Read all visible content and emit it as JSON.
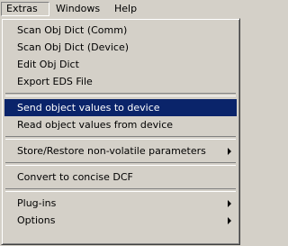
{
  "menubar": {
    "items": [
      {
        "label": "Extras"
      },
      {
        "label": "Windows"
      },
      {
        "label": "Help"
      }
    ]
  },
  "menu": {
    "group1": [
      {
        "label": "Scan Obj Dict (Comm)"
      },
      {
        "label": "Scan Obj Dict (Device)"
      },
      {
        "label": "Edit Obj Dict"
      },
      {
        "label": "Export EDS File"
      }
    ],
    "group2": [
      {
        "label": "Send object values to device",
        "highlighted": true
      },
      {
        "label": "Read object values from device"
      }
    ],
    "group3": [
      {
        "label": "Store/Restore non-volatile parameters",
        "submenu": true
      }
    ],
    "group4": [
      {
        "label": "Convert to concise DCF"
      }
    ],
    "group5": [
      {
        "label": "Plug-ins",
        "submenu": true
      },
      {
        "label": "Options",
        "submenu": true
      }
    ]
  },
  "colors": {
    "menu_bg": "#d4d0c8",
    "highlight_bg": "#0a246a",
    "highlight_fg": "#ffffff"
  }
}
